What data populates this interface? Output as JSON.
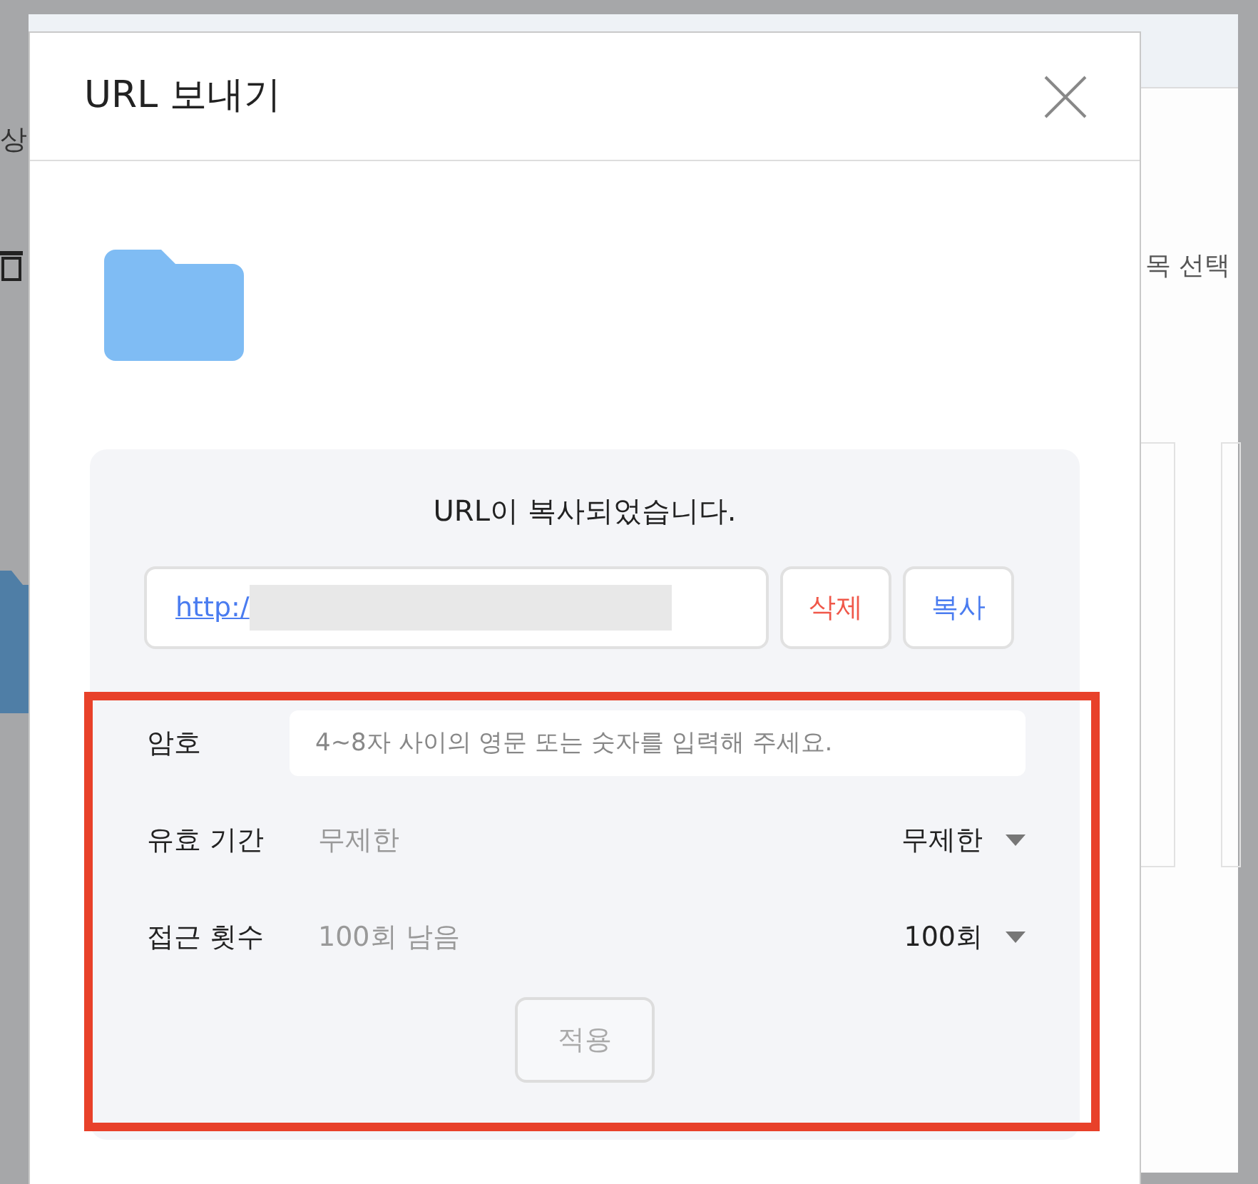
{
  "background": {
    "left_text": "상",
    "right_text": "목 선택"
  },
  "dialog": {
    "title": "URL 보내기",
    "message": "URL이 복사되었습니다.",
    "url": {
      "value": "http:/"
    },
    "url_buttons": [
      {
        "label": "삭제",
        "kind": "danger"
      },
      {
        "label": "복사",
        "kind": "primary"
      }
    ],
    "settings": [
      {
        "kind": "input",
        "label": "암호",
        "placeholder": "4~8자 사이의 영문 또는 숫자를 입력해 주세요."
      },
      {
        "kind": "select",
        "label": "유효 기간",
        "current": "무제한",
        "value": "무제한"
      },
      {
        "kind": "select",
        "label": "접근 횟수",
        "current": "100회 남음",
        "value": "100회"
      }
    ],
    "apply_button": {
      "label": "적용",
      "disabled": true
    },
    "highlight": {
      "color": "#e8412a"
    }
  }
}
